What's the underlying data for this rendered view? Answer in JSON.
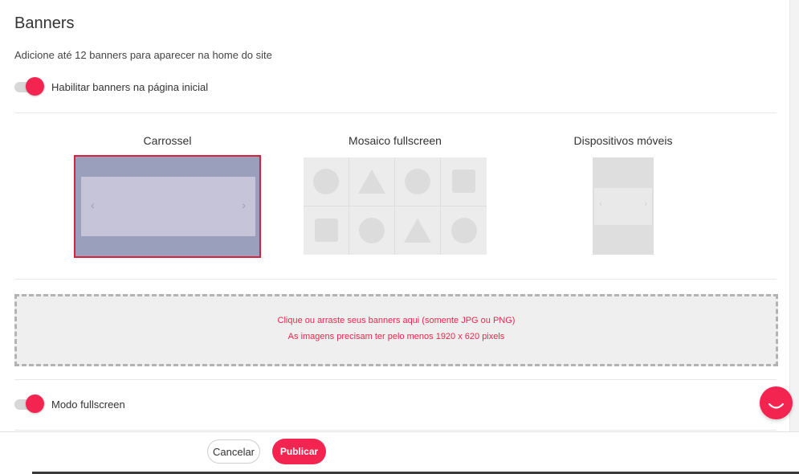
{
  "page": {
    "title": "Banners",
    "subtitle": "Adicione até 12 banners para aparecer na home do site"
  },
  "toggles": {
    "enable_banners": {
      "label": "Habilitar banners na página inicial",
      "on": true
    },
    "fullscreen_mode": {
      "label": "Modo fullscreen",
      "on": true
    }
  },
  "layouts": [
    {
      "label": "Carrossel",
      "selected": true
    },
    {
      "label": "Mosaico fullscreen",
      "selected": false
    },
    {
      "label": "Dispositivos móveis",
      "selected": false
    }
  ],
  "dropzone": {
    "line1": "Clique ou arraste seus banners aqui (somente JPG ou PNG)",
    "line2": "As imagens precisam ter pelo menos 1920 x 620 pixels"
  },
  "footer": {
    "cancel_label": "Cancelar",
    "publish_label": "Publicar"
  },
  "icons": {
    "arrow_left": "‹",
    "arrow_right": "›"
  },
  "colors": {
    "accent": "#f3244f",
    "selected_border": "#d6213f",
    "dropzone_text": "#e8264d"
  }
}
